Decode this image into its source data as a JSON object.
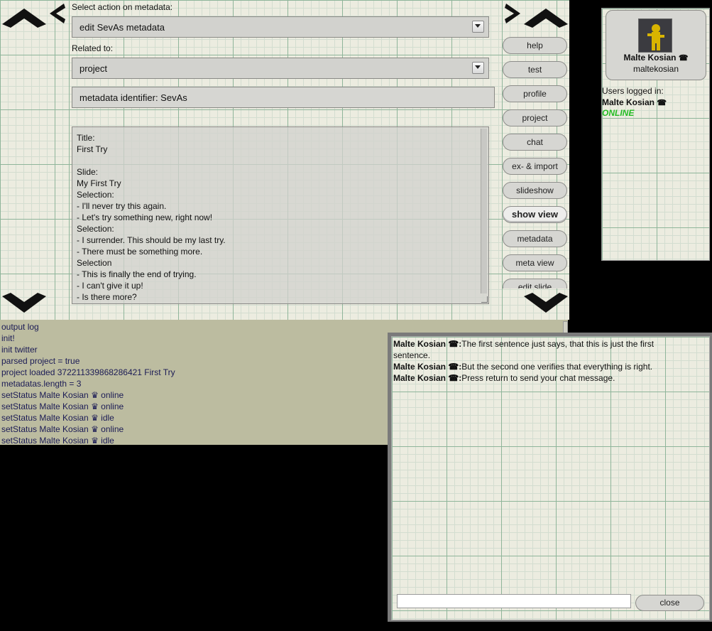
{
  "metadata_panel": {
    "action_label": "Select action on metadata:",
    "action_value": "edit SevAs metadata",
    "related_label": "Related to:",
    "related_value": "project",
    "identifier": "metadata identifier: SevAs",
    "content_lines": [
      "Title:",
      "First Try",
      "",
      "Slide:",
      "My First Try",
      "Selection:",
      "- I'll never try this again.",
      "- Let's try something new, right now!",
      "Selection:",
      "- I surrender. This should be my last try.",
      "- There must be something more.",
      "Selection",
      "- This is finally the end of trying.",
      "- I can't give it up!",
      "- Is there more?"
    ]
  },
  "nav_buttons": [
    "help",
    "test",
    "profile",
    "project",
    "chat",
    "ex- & import",
    "slideshow",
    "show view",
    "metadata",
    "meta view",
    "edit slide"
  ],
  "active_nav": "show view",
  "user_panel": {
    "display_name": "Malte Kosian",
    "username": "maltekosian",
    "users_logged_in_label": "Users logged in:",
    "online_user": "Malte Kosian",
    "status": "ONLINE",
    "status_color": "#22bb22"
  },
  "output_log": {
    "title": "output log",
    "lines": [
      "init!",
      "init twitter",
      "parsed project = true",
      "project loaded 372211339868286421 First Try",
      "metadatas.length = 3",
      "setStatus Malte Kosian ♛ online",
      "setStatus Malte Kosian ♛ online",
      "setStatus Malte Kosian ♛ idle",
      "setStatus Malte Kosian ♛ online",
      "setStatus Malte Kosian ♛ idle"
    ]
  },
  "chat": {
    "messages": [
      {
        "sender": "Malte Kosian ☎:",
        "text": "The first sentence just says, that this is just the first sentence."
      },
      {
        "sender": "Malte Kosian ☎:",
        "text": "But the second one verifies that everything is right."
      },
      {
        "sender": "Malte Kosian ☎:",
        "text": "Press return to send your chat message."
      }
    ],
    "input_value": "",
    "close_label": "close"
  },
  "icons": {
    "up": "chevron-up-icon",
    "down": "chevron-down-icon",
    "left": "chevron-left-icon",
    "right": "chevron-right-icon",
    "crown": "♛",
    "phone": "☎"
  }
}
